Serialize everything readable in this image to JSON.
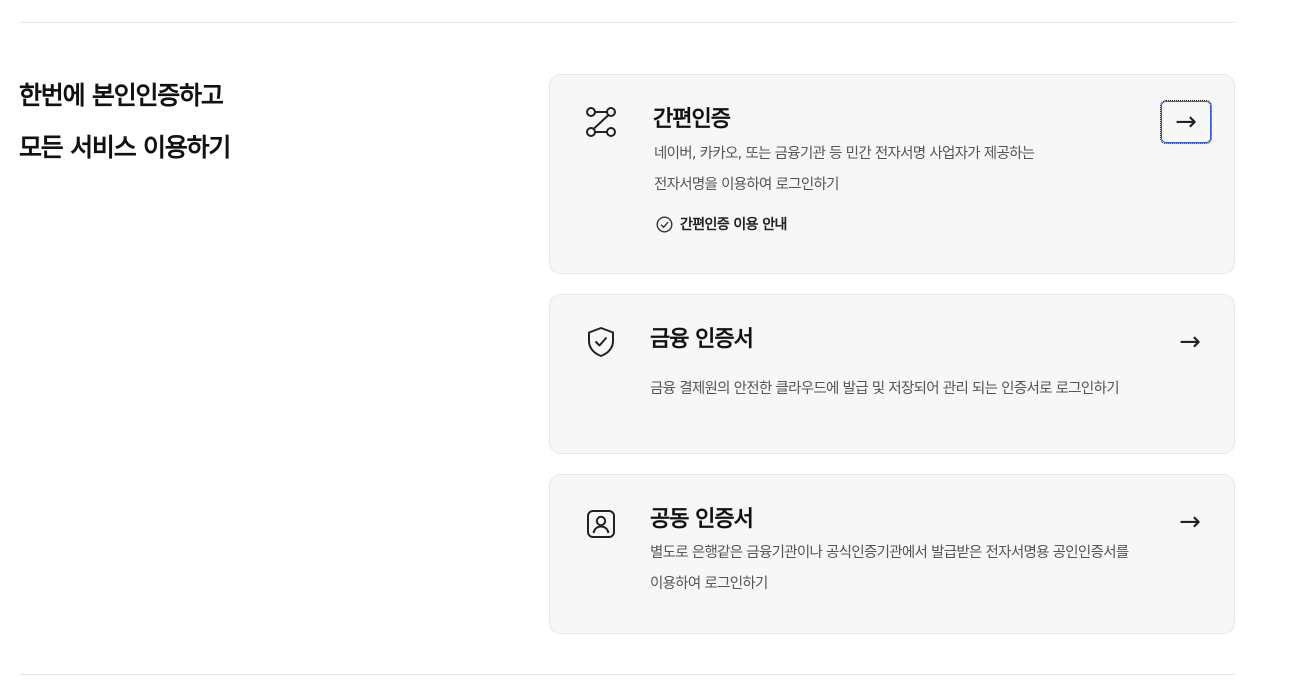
{
  "intro": {
    "line1": "한번에 본인인증하고",
    "line2": "모든 서비스 이용하기"
  },
  "cards": [
    {
      "icon": "route-nodes-icon",
      "title": "간편인증",
      "desc_line1": "네이버, 카카오, 또는 금융기관 등 민간 전자서명 사업자가 제공하는",
      "desc_line2": "전자서명을 이용하여 로그인하기",
      "guide": "간편인증 이용 안내",
      "arrow": "→"
    },
    {
      "icon": "shield-check-icon",
      "title": "금융 인증서",
      "desc_line1": "금융 결제원의 안전한 클라우드에 발급 및 저장되어 관리 되는 인증서로 로그인하기",
      "arrow": "→"
    },
    {
      "icon": "user-id-icon",
      "title": "공동 인증서",
      "desc_line1": "별도로 은행같은 금융기관이나 공식인증기관에서 발급받은 전자서명용 공인인증서를",
      "desc_line2": "이용하여 로그인하기",
      "arrow": "→"
    }
  ],
  "colors": {
    "card_bg": "#f7f7f7",
    "card_border": "#e8e8e8",
    "focus_ring": "#3a5bd9",
    "text_primary": "#111111",
    "text_secondary": "#555555"
  }
}
